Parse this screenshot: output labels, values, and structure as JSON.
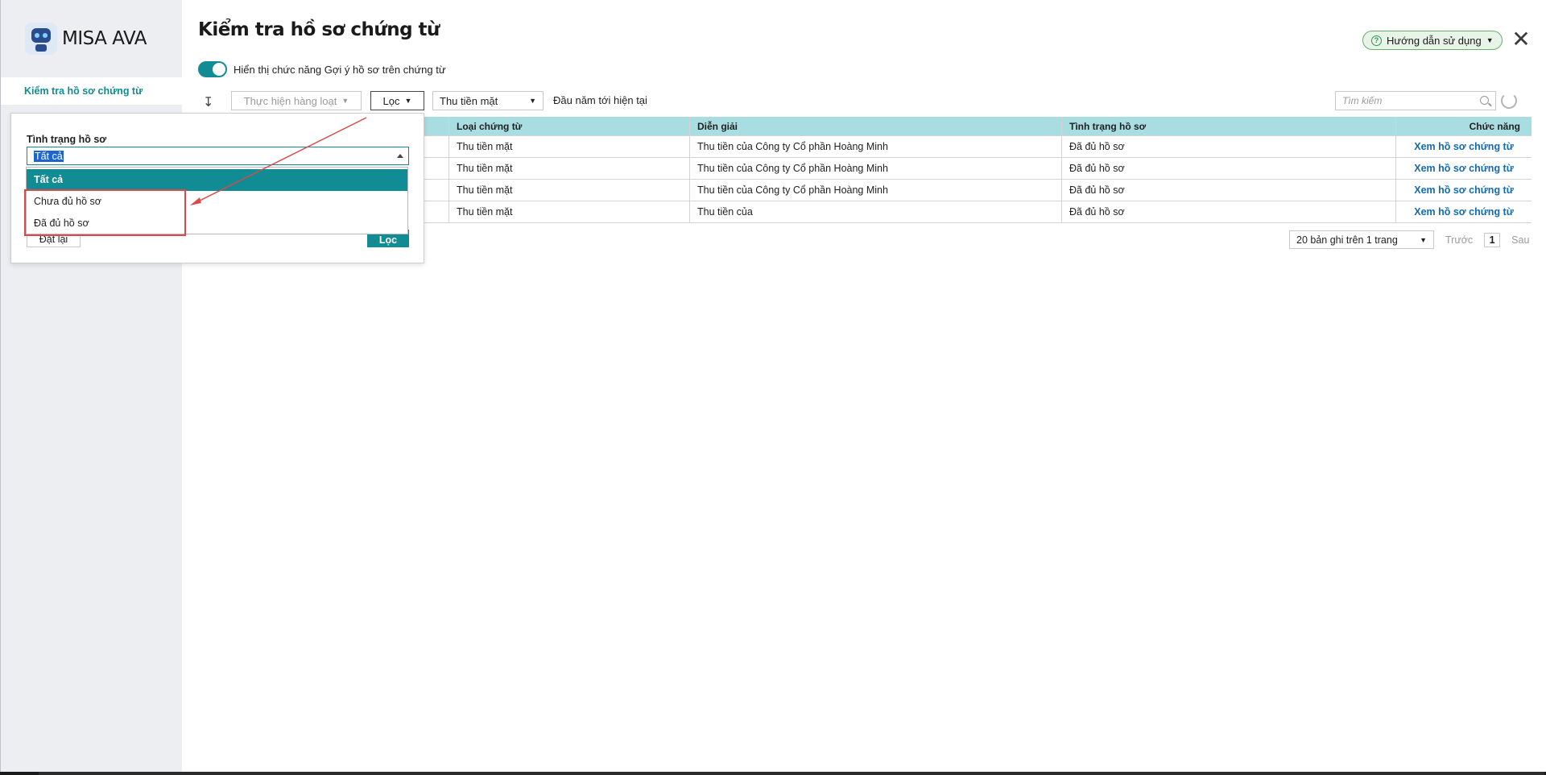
{
  "app": {
    "name": "MISA AVA"
  },
  "sidebar": {
    "items": [
      {
        "label": "Kiểm tra hồ sơ chứng từ"
      }
    ]
  },
  "header": {
    "title": "Kiểm tra hồ sơ chứng từ",
    "help_label": "Hướng dẫn sử dụng",
    "close_symbol": "✕"
  },
  "toggle": {
    "label": "Hiển thị chức năng Gợi ý hồ sơ trên chứng từ",
    "on": true
  },
  "toolbar": {
    "sort_symbol": "↧",
    "bulk_label": "Thực hiện hàng loạt",
    "filter_label": "Lọc",
    "doc_type_value": "Thu tiền mặt",
    "period_text": "Đầu năm tới hiện tại",
    "search_placeholder": "Tìm kiếm"
  },
  "table": {
    "columns": [
      "",
      "Loại chứng từ",
      "Diễn giải",
      "Tình trạng hồ sơ",
      "Chức năng"
    ],
    "rows": [
      {
        "type": "Thu tiền mặt",
        "desc": "Thu tiền của Công ty Cổ phần Hoàng Minh",
        "status": "Đã đủ hồ sơ",
        "action": "Xem hồ sơ chứng từ"
      },
      {
        "type": "Thu tiền mặt",
        "desc": "Thu tiền của Công ty Cổ phần Hoàng Minh",
        "status": "Đã đủ hồ sơ",
        "action": "Xem hồ sơ chứng từ"
      },
      {
        "type": "Thu tiền mặt",
        "desc": "Thu tiền của Công ty Cổ phần Hoàng Minh",
        "status": "Đã đủ hồ sơ",
        "action": "Xem hồ sơ chứng từ"
      },
      {
        "type": "Thu tiền mặt",
        "desc": "Thu tiền của",
        "status": "Đã đủ hồ sơ",
        "action": "Xem hồ sơ chứng từ"
      }
    ]
  },
  "pagination": {
    "page_size_label": "20 bản ghi trên 1 trang",
    "prev_label": "Trước",
    "current_page": "1",
    "next_label": "Sau"
  },
  "filter_popup": {
    "field_label": "Tình trạng hồ sơ",
    "selected_value": "Tất cả",
    "options": [
      "Tất cả",
      "Chưa đủ hồ sơ",
      "Đã đủ hồ sơ"
    ],
    "reset_label": "Đặt lại",
    "apply_label": "Lọc"
  },
  "colors": {
    "accent": "#118b94",
    "table_header": "#a8dde2",
    "link": "#136bb4",
    "annotation": "#d94a4a",
    "help_badge_bg": "#e7f4e7"
  }
}
